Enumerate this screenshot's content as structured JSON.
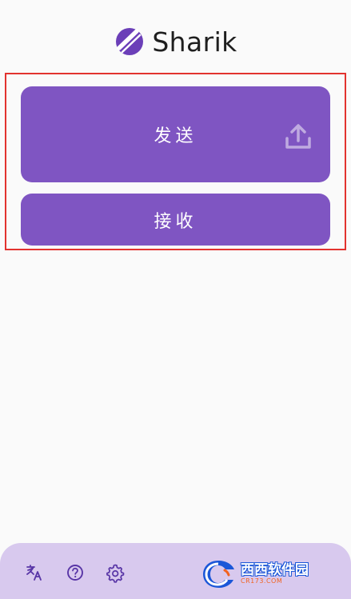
{
  "app": {
    "title": "Sharik"
  },
  "actions": {
    "send_label": "发送",
    "receive_label": "接收"
  },
  "bottom_bar": {
    "icons": [
      "translate-icon",
      "help-icon",
      "settings-icon"
    ]
  },
  "watermark": {
    "brand": "西西软件园",
    "site": "CR173.COM"
  },
  "colors": {
    "accent": "#7f55c2",
    "bottom_bar": "#d8c9ee",
    "highlight": "#e2332f",
    "text": "#1f1f1f"
  }
}
